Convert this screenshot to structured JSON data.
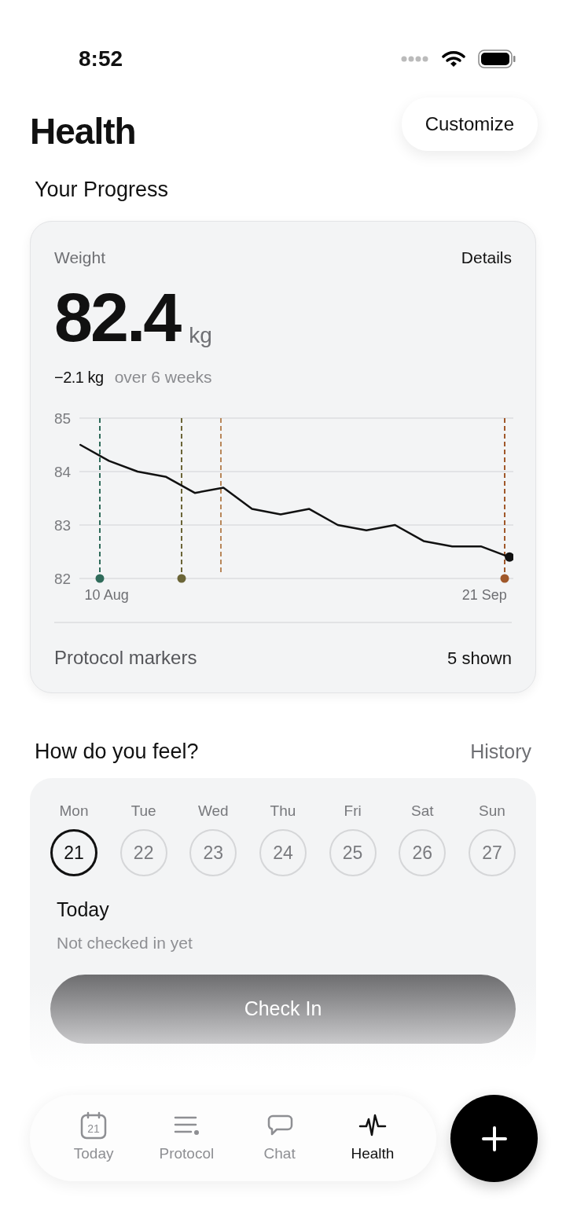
{
  "status_bar": {
    "time": "8:52"
  },
  "header": {
    "title": "Health",
    "action": "Customize"
  },
  "progress": {
    "title": "Your Progress",
    "card": {
      "label": "Weight",
      "link": "Details",
      "value": "82.4",
      "unit": "kg",
      "change": "−2.1 kg",
      "change_note": "over 6 weeks",
      "chart_data": {
        "type": "line",
        "categories": [
          null,
          "10 Aug",
          null,
          null,
          null,
          null,
          null,
          null,
          null,
          null,
          null,
          null,
          null,
          null,
          "21 Sep",
          null
        ],
        "series": [
          {
            "color": "#111111",
            "values": [
              84.5,
              84.2,
              84.0,
              83.9,
              83.6,
              83.7,
              83.3,
              83.2,
              83.3,
              83.0,
              82.9,
              83.0,
              82.7,
              82.6,
              82.6,
              82.4
            ]
          }
        ],
        "ylim": [
          82,
          85
        ],
        "yticks": [
          82,
          83,
          84,
          85
        ]
      },
      "markers": [
        {
          "color": "#2f6b5a",
          "dot": true
        },
        {
          "color": "#6b6537",
          "dot": true
        },
        {
          "color": "#b8875a",
          "dot": false
        },
        {
          "color": "#a0582a",
          "dot": true
        }
      ],
      "footer_label": "Protocol markers",
      "footer_value": "5 shown"
    }
  },
  "feel": {
    "title": "How do you feel?",
    "link": "History",
    "days": [
      {
        "day": "Mon",
        "date": "21",
        "selected": true
      },
      {
        "day": "Tue",
        "date": "22",
        "selected": false
      },
      {
        "day": "Wed",
        "date": "23",
        "selected": false
      },
      {
        "day": "Thu",
        "date": "24",
        "selected": false
      },
      {
        "day": "Fri",
        "date": "25",
        "selected": false
      },
      {
        "day": "Sat",
        "date": "26",
        "selected": false
      },
      {
        "day": "Sun",
        "date": "27",
        "selected": false
      }
    ],
    "today_title": "Today",
    "today_status": "Not checked in yet",
    "button": "Check In"
  },
  "tab_bar": {
    "items": [
      {
        "kind": "calendar",
        "label": "Today",
        "icon_text": "21",
        "selected": false
      },
      {
        "kind": "list",
        "label": "Protocol",
        "selected": false
      },
      {
        "kind": "chat",
        "label": "Chat",
        "selected": false
      },
      {
        "kind": "pulse",
        "label": "Health",
        "selected": true
      }
    ]
  }
}
